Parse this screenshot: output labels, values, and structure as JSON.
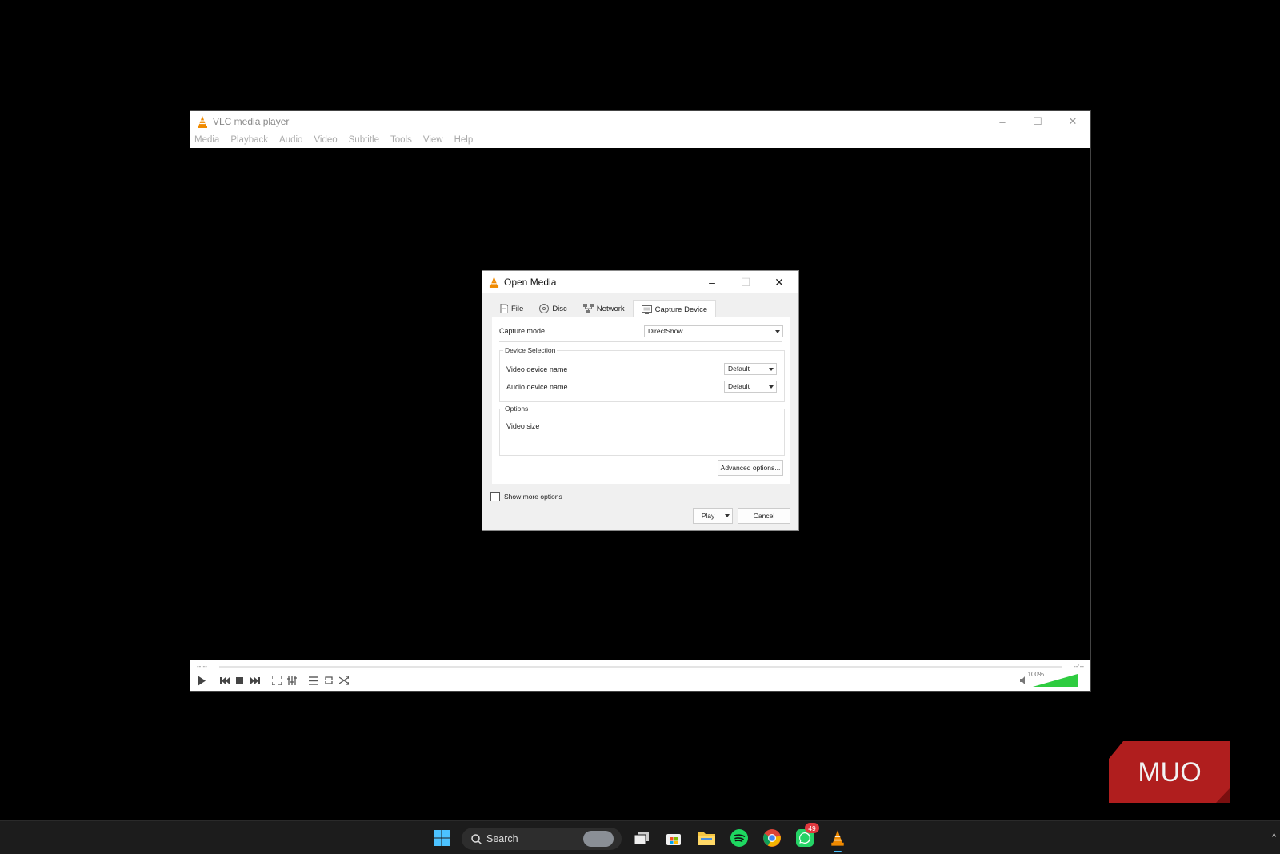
{
  "vlc": {
    "title": "VLC media player",
    "menu": [
      "Media",
      "Playback",
      "Audio",
      "Video",
      "Subtitle",
      "Tools",
      "View",
      "Help"
    ],
    "time_elapsed": "--:--",
    "time_total": "--:--",
    "volume_label": "100%",
    "volume_level": 1.0
  },
  "dialog": {
    "title": "Open Media",
    "tabs": [
      "File",
      "Disc",
      "Network",
      "Capture Device"
    ],
    "active_tab": "Capture Device",
    "capture_mode_label": "Capture mode",
    "capture_mode_value": "DirectShow",
    "device_selection_title": "Device Selection",
    "video_device_label": "Video device name",
    "video_device_value": "Default",
    "audio_device_label": "Audio device name",
    "audio_device_value": "Default",
    "options_title": "Options",
    "video_size_label": "Video size",
    "video_size_value": "",
    "advanced_button": "Advanced options...",
    "show_more_label": "Show more options",
    "show_more_checked": false,
    "play_button": "Play",
    "cancel_button": "Cancel"
  },
  "taskbar": {
    "search_label": "Search",
    "whatsapp_badge": "49"
  },
  "watermark": "MUO",
  "colors": {
    "vlc_orange": "#f08a00",
    "volume_green": "#2ecc40",
    "badge_red": "#e0383e",
    "muo_red": "#c41e1e"
  }
}
